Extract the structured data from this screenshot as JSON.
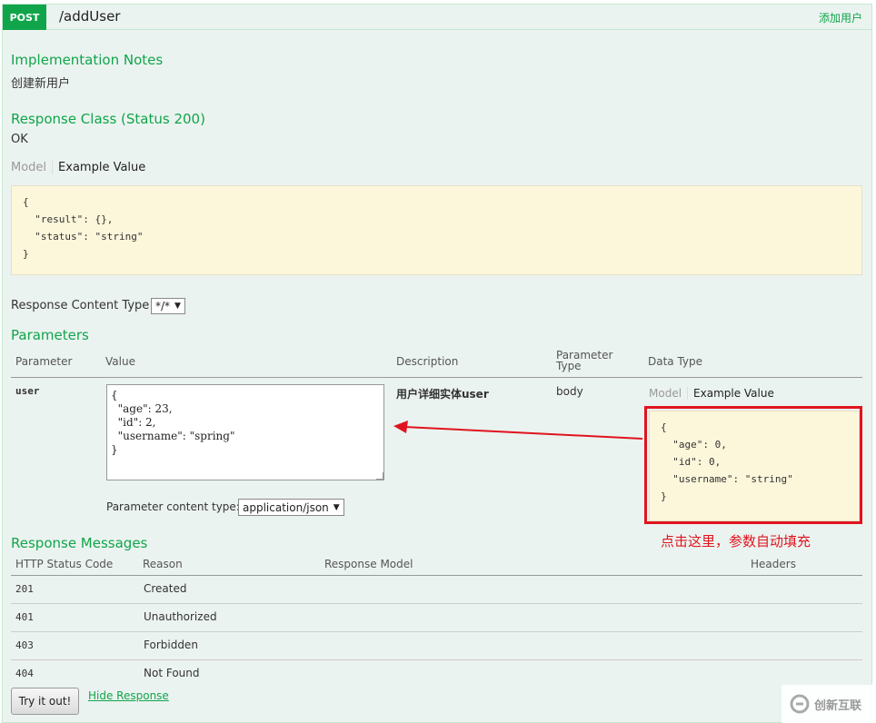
{
  "operation": {
    "method": "POST",
    "path": "/addUser",
    "summary": "添加用户"
  },
  "implementation": {
    "title": "Implementation Notes",
    "text": "创建新用户"
  },
  "response_class": {
    "title": "Response Class (Status 200)",
    "text": "OK",
    "tab_model": "Model",
    "tab_example": "Example Value",
    "snippet_lines": [
      "{",
      "  \"result\": {},",
      "  \"status\": \"string\"",
      "}"
    ]
  },
  "content_type": {
    "label": "Response Content Type",
    "value": "*/*"
  },
  "parameters": {
    "title": "Parameters",
    "headers": {
      "parameter": "Parameter",
      "value": "Value",
      "description": "Description",
      "parameter_type": "Parameter Type",
      "data_type": "Data Type"
    },
    "row": {
      "name": "user",
      "value_text": "{\n  \"age\": 23,\n  \"id\": 2,\n  \"username\": \"spring\"\n}",
      "description": "用户详细实体user",
      "param_type": "body",
      "tab_model": "Model",
      "tab_example": "Example Value",
      "example_lines": [
        "{",
        "  \"age\": 0,",
        "  \"id\": 0,",
        "  \"username\": \"string\"",
        "}"
      ]
    },
    "content_type_label": "Parameter content type:",
    "content_type_value": "application/json"
  },
  "annotation": {
    "text": "点击这里，参数自动填充",
    "color": "#e0141e"
  },
  "response_messages": {
    "title": "Response Messages",
    "headers": {
      "code": "HTTP Status Code",
      "reason": "Reason",
      "model": "Response Model",
      "headers": "Headers"
    },
    "rows": [
      {
        "code": "201",
        "reason": "Created"
      },
      {
        "code": "401",
        "reason": "Unauthorized"
      },
      {
        "code": "403",
        "reason": "Forbidden"
      },
      {
        "code": "404",
        "reason": "Not Found"
      }
    ]
  },
  "actions": {
    "try_label": "Try it out!",
    "hide_label": "Hide Response"
  },
  "watermark": {
    "text": "创新互联",
    "icon": "logo-icon"
  },
  "colors": {
    "accent": "#10a54a",
    "panel_bg": "#ebf3f0",
    "snippet_bg": "#fcf6db"
  }
}
